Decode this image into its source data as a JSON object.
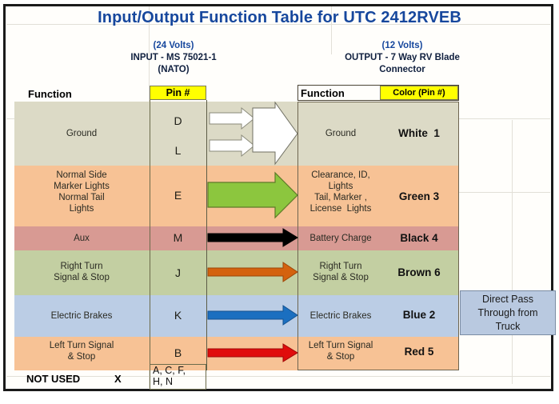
{
  "title": "Input/Output Function Table for UTC 2412RVEB",
  "input_header": {
    "volts": "(24 Volts)",
    "line1": "INPUT - MS 75021-1",
    "line2": "(NATO)",
    "function_label": "Function",
    "pin_label": "Pin #"
  },
  "output_header": {
    "volts": "(12 Volts)",
    "line1": "OUTPUT - 7 Way RV Blade",
    "line2": "Connector",
    "function_label": "Function",
    "color_label": "Color (Pin #)"
  },
  "rows": [
    {
      "input_function": "Ground",
      "pins": [
        "D",
        "L"
      ],
      "output_function": "Ground",
      "output_color": "White  1",
      "row_color": "#dcdac6",
      "arrow_color": "#ffffff",
      "arrow_style": "merge-white"
    },
    {
      "input_function": "Normal Side\nMarker Lights\nNormal Tail\nLights",
      "pins": [
        "E"
      ],
      "output_function": "Clearance, ID,\nLights\nTail, Marker ,\nLicense  Lights",
      "output_color": "Green 3",
      "row_color": "#f7c295",
      "arrow_color": "#8cc63e",
      "arrow_style": "wide"
    },
    {
      "input_function": "Aux",
      "pins": [
        "M"
      ],
      "output_function": "Battery Charge",
      "output_color": "Black 4",
      "row_color": "#d89a93",
      "arrow_color": "#000000",
      "arrow_style": "thin"
    },
    {
      "input_function": "Right Turn\nSignal & Stop",
      "pins": [
        "J"
      ],
      "output_function": "Right Turn\nSignal & Stop",
      "output_color": "Brown 6",
      "row_color": "#c3cfa2",
      "arrow_color": "#d4620e",
      "arrow_style": "thin"
    },
    {
      "input_function": "Electric Brakes",
      "pins": [
        "K"
      ],
      "output_function": "Electric Brakes",
      "output_color": "Blue 2",
      "row_color": "#bbcde5",
      "arrow_color": "#1b6fc0",
      "arrow_style": "thin"
    },
    {
      "input_function": "Left Turn Signal\n& Stop",
      "pins": [
        "B"
      ],
      "output_function": "Left Turn Signal\n& Stop",
      "output_color": "Red 5",
      "row_color": "#f7c295",
      "arrow_color": "#e00c0c",
      "arrow_style": "thin"
    }
  ],
  "not_used": {
    "label": "NOT USED",
    "mark": "X",
    "pins_line1": "A, C, F,",
    "pins_line2": "H, N"
  },
  "pass_through": {
    "line1": "Direct Pass",
    "line2": "Through from",
    "line3": "Truck"
  },
  "colors": {
    "title_blue": "#16479d",
    "yellow": "#ffff00",
    "frame": "#1a1a1a",
    "pass_through_bg": "#b9c9e0"
  }
}
